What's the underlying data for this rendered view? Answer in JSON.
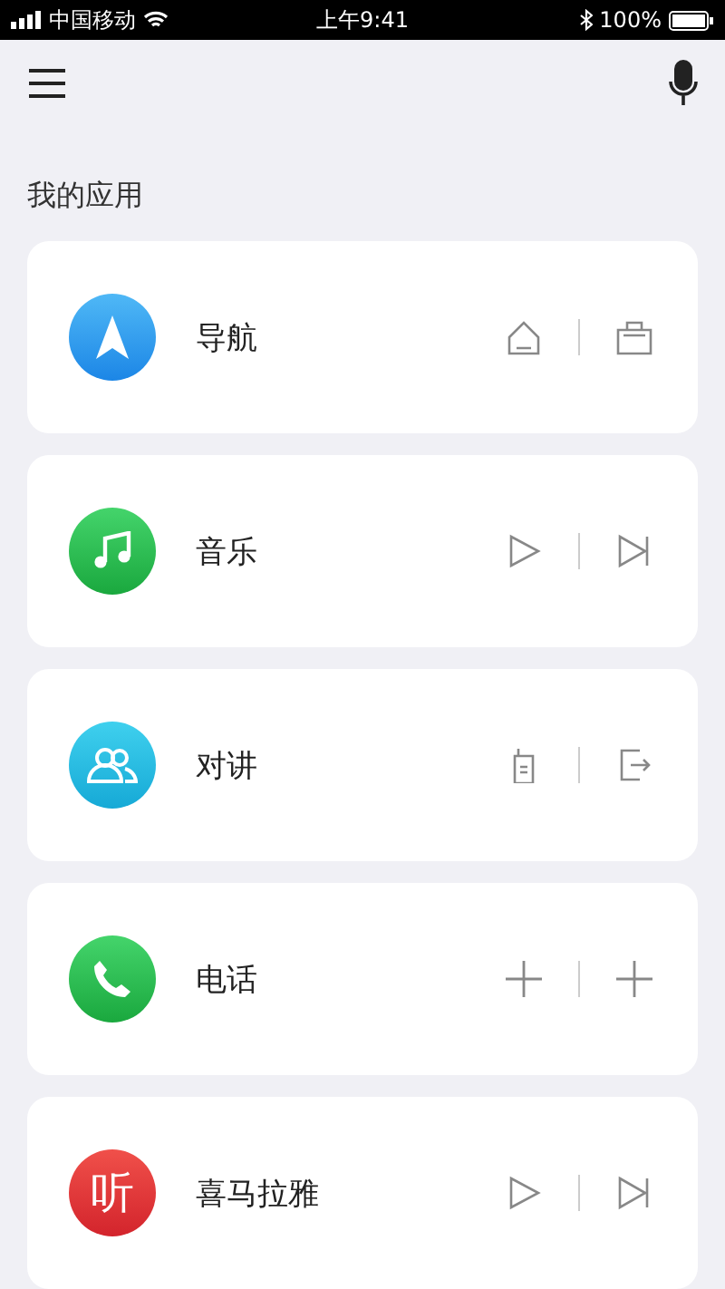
{
  "status_bar": {
    "carrier": "中国移动",
    "time": "上午9:41",
    "battery": "100%"
  },
  "section_title": "我的应用",
  "apps": [
    {
      "name": "导航",
      "kind": "navigation",
      "actions": [
        {
          "kind": "home"
        },
        {
          "kind": "briefcase"
        }
      ]
    },
    {
      "name": "音乐",
      "kind": "music",
      "actions": [
        {
          "kind": "play"
        },
        {
          "kind": "next"
        }
      ]
    },
    {
      "name": "对讲",
      "kind": "intercom",
      "actions": [
        {
          "kind": "walkie"
        },
        {
          "kind": "exit"
        }
      ]
    },
    {
      "name": "电话",
      "kind": "phone",
      "actions": [
        {
          "kind": "plus"
        },
        {
          "kind": "plus"
        }
      ]
    },
    {
      "name": "喜马拉雅",
      "kind": "listen",
      "icon_text": "听",
      "actions": [
        {
          "kind": "play"
        },
        {
          "kind": "next"
        }
      ]
    }
  ]
}
